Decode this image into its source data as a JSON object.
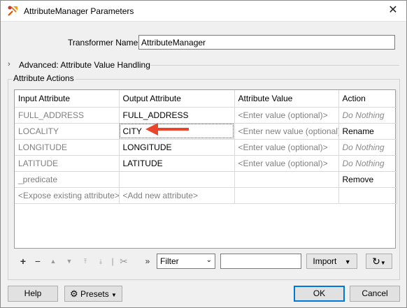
{
  "window": {
    "title": "AttributeManager Parameters"
  },
  "transformer": {
    "label": "Transformer Name:",
    "value": "AttributeManager"
  },
  "advanced": {
    "label": "Advanced: Attribute Value Handling"
  },
  "attribute_actions": {
    "label": "Attribute Actions",
    "headers": [
      "Input Attribute",
      "Output Attribute",
      "Attribute Value",
      "Action"
    ],
    "rows": [
      {
        "input": "FULL_ADDRESS",
        "output": "FULL_ADDRESS",
        "value": "<Enter value (optional)>",
        "action": "Do Nothing"
      },
      {
        "input": "LOCALITY",
        "output": "CITY",
        "value": "<Enter new value (optional)>",
        "action": "Rename"
      },
      {
        "input": "LONGITUDE",
        "output": "LONGITUDE",
        "value": "<Enter value (optional)>",
        "action": "Do Nothing"
      },
      {
        "input": "LATITUDE",
        "output": "LATITUDE",
        "value": "<Enter value (optional)>",
        "action": "Do Nothing"
      },
      {
        "input": "_predicate",
        "output": "",
        "value": "",
        "action": "Remove"
      },
      {
        "input": "<Expose existing attribute>",
        "output": "<Add new attribute>",
        "value": "",
        "action": ""
      }
    ]
  },
  "toolbar": {
    "filter_value": "Filter",
    "import_label": "Import",
    "icons": [
      "plus-icon",
      "minus-icon",
      "move-up-icon",
      "move-down-icon",
      "move-top-icon",
      "move-bottom-icon",
      "cut-icon",
      "more-icon",
      "refresh-icon"
    ]
  },
  "footer": {
    "help": "Help",
    "presets": "Presets",
    "ok": "OK",
    "cancel": "Cancel"
  },
  "colors": {
    "annotation_arrow": "#e8452a",
    "ok_border": "#0078d7"
  }
}
